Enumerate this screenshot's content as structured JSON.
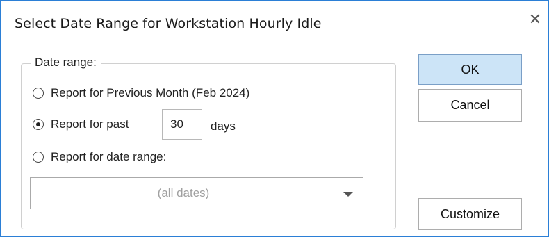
{
  "dialog": {
    "title": "Select Date Range for Workstation Hourly Idle",
    "close_symbol": "✕"
  },
  "date_range": {
    "legend": "Date range:",
    "options": [
      {
        "label": "Report for Previous Month (Feb 2024)",
        "checked": false
      },
      {
        "label": "Report for past",
        "checked": true
      },
      {
        "label": "Report for date range:",
        "checked": false
      }
    ],
    "past_days_value": "30",
    "days_label": "days",
    "range_select_value": "(all dates)"
  },
  "buttons": {
    "ok": "OK",
    "cancel": "Cancel",
    "customize": "Customize"
  }
}
